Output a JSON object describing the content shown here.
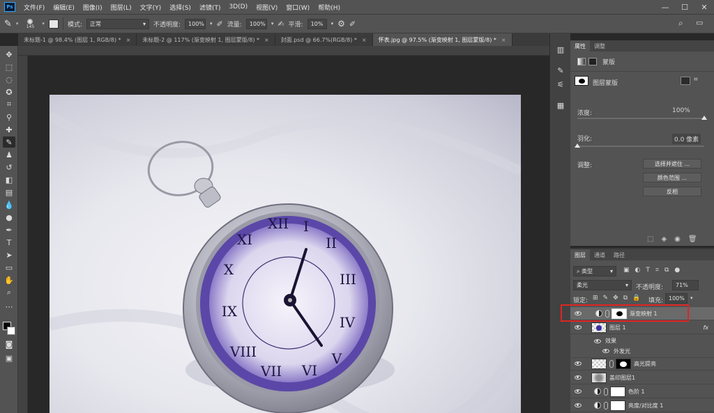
{
  "menu": [
    "文件(F)",
    "编辑(E)",
    "图像(I)",
    "图层(L)",
    "文字(Y)",
    "选择(S)",
    "滤镜(T)",
    "3D(D)",
    "视图(V)",
    "窗口(W)",
    "帮助(H)"
  ],
  "app_logo": "Ps",
  "window_controls": [
    "—",
    "☐",
    "✕"
  ],
  "options": {
    "brush_size": "145",
    "mode_label": "模式:",
    "mode_value": "正常",
    "opacity_label": "不透明度:",
    "opacity_value": "100%",
    "flow_label": "流量:",
    "flow_value": "100%",
    "smooth_label": "平滑:",
    "smooth_value": "10%"
  },
  "tabs": [
    {
      "label": "未标题-1 @ 98.4% (图层 1, RGB/8) *",
      "active": false
    },
    {
      "label": "未标题-2 @ 117% (渐变映射 1, 图层蒙版/8) *",
      "active": false
    },
    {
      "label": "封面.psd @ 66.7%(RGB/8) *",
      "active": false
    },
    {
      "label": "怀表.jpg @ 97.5% (渐变映射 1, 图层蒙版/8) *",
      "active": true
    }
  ],
  "properties": {
    "tabs": [
      "属性",
      "调整"
    ],
    "mask_label": "蒙版",
    "layer_mask_label": "图层蒙版",
    "density_label": "浓度:",
    "density_value": "100%",
    "density_fraction": 1.0,
    "feather_label": "羽化:",
    "feather_value": "0.0 像素",
    "feather_fraction": 0.0,
    "adjust_label": "调整:",
    "buttons": [
      "选择并遮住 ...",
      "颜色范围 ...",
      "反相"
    ]
  },
  "layers": {
    "tabs": [
      "图层",
      "通道",
      "路径"
    ],
    "filter_kind": "类型",
    "blend_mode": "柔光",
    "opacity_label": "不透明度:",
    "opacity_value": "71%",
    "lock_label": "锁定:",
    "fill_label": "填充:",
    "fill_value": "100%",
    "rows": [
      {
        "name": "渐变映射 1",
        "type": "adjust-mask",
        "selected": true
      },
      {
        "name": "图层 1",
        "type": "layer-fx",
        "fx": "fx"
      },
      {
        "name": "效果",
        "type": "effect"
      },
      {
        "name": "外发光",
        "type": "effect-sub"
      },
      {
        "name": "高光提亮",
        "type": "layer-mask"
      },
      {
        "name": "盖印图层1",
        "type": "layer"
      },
      {
        "name": "色阶 1",
        "type": "adjust"
      },
      {
        "name": "亮度/对比度 1",
        "type": "adjust"
      }
    ]
  },
  "colors": {
    "highlight": "#e02424",
    "ui_dark": "#535353",
    "accent": "#31a8ff"
  }
}
